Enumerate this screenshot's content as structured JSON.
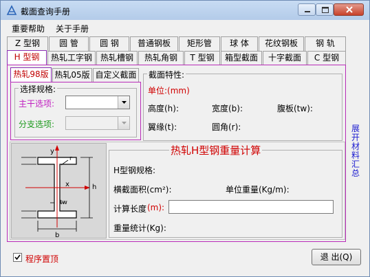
{
  "window": {
    "title": "截面查询手册"
  },
  "menu": [
    "重要帮助",
    "关于手册"
  ],
  "tabs_row1": [
    "Z 型钢",
    "圆  管",
    "圆  钢",
    "普通钢板",
    "矩形管",
    "球  体",
    "花纹钢板",
    "钢  轨"
  ],
  "tabs_row2": [
    "H 型钢",
    "热轧工字钢",
    "热轧槽钢",
    "热轧角钢",
    "T 型钢",
    "箱型截面",
    "十字截面",
    "C 型钢"
  ],
  "subtabs": [
    "热轧98版",
    "热轧05版",
    "自定义截面"
  ],
  "spec_group": {
    "title": "选择规格:",
    "main_label": "主干选项:",
    "branch_label": "分支选项:"
  },
  "props_group": {
    "title": "截面特性:",
    "unit_label": "单位:(mm)",
    "height": "高度(h):",
    "width": "宽度(b):",
    "web": "腹板(tw):",
    "flange": "翼缘(t):",
    "fillet": "圆角(r):"
  },
  "side_text": "展开材料汇总",
  "weight_group": {
    "title": "热轧H型钢重量计算",
    "spec": "H型钢规格:",
    "area": "横截面积(cm²):",
    "unit_weight": "单位重量(Kg/m):",
    "length_label": "计算长度",
    "length_unit": "(m):",
    "total": "重量统计(Kg):"
  },
  "diagram": {
    "y": "y",
    "x": "x",
    "h": "h",
    "b": "b",
    "tw": "tw",
    "r": "r"
  },
  "footer": {
    "checkbox_label": "程序置顶",
    "checked": true,
    "exit_label": "退 出(Q)"
  },
  "colors": {
    "accent_red": "#d00000",
    "accent_magenta": "#c01cc0",
    "accent_green": "#1c9a1c"
  }
}
